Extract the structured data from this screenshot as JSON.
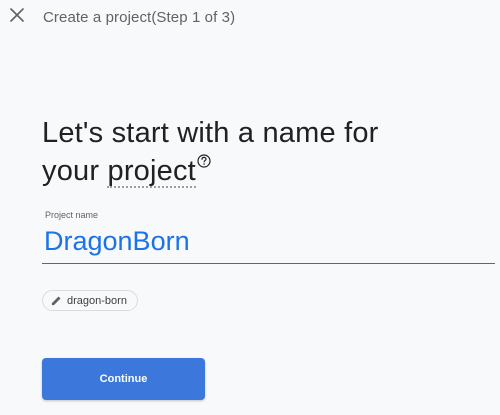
{
  "topbar": {
    "close_icon": "close-icon",
    "step_title": "Create a project(Step 1 of 3)"
  },
  "heading": {
    "line1": "Let's start with a name for",
    "line2_prefix": "your ",
    "line2_keyword": "project",
    "help_icon": "help-circle-icon"
  },
  "project_name_field": {
    "label": "Project name",
    "value": "DragonBorn"
  },
  "project_id_chip": {
    "icon": "pencil-icon",
    "label": "dragon-born"
  },
  "continue_button": {
    "label": "Continue"
  },
  "colors": {
    "accent": "#1a73e8",
    "button": "#3c78db",
    "background": "#f8f9fa",
    "text": "#202124",
    "secondary_text": "#5f6368"
  }
}
